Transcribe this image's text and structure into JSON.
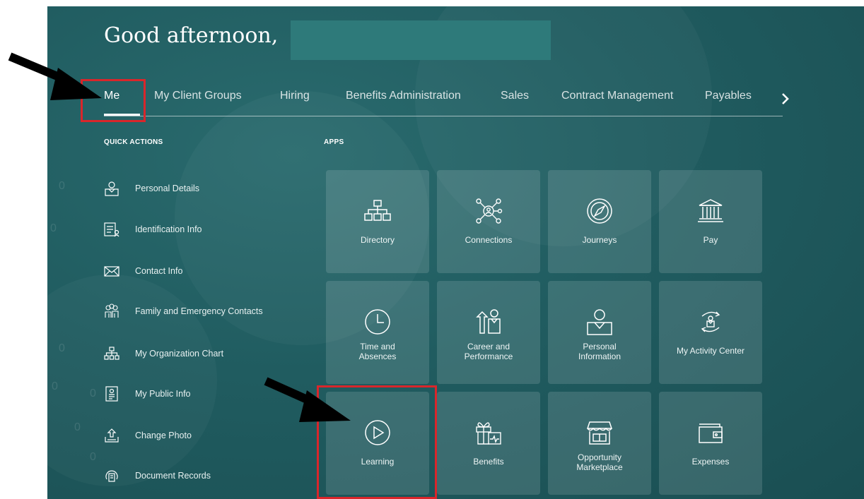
{
  "greeting": "Good afternoon,",
  "nav": {
    "tabs": [
      "Me",
      "My Client Groups",
      "Hiring",
      "Benefits Administration",
      "Sales",
      "Contract Management",
      "Payables"
    ],
    "active": "Me",
    "next_icon": "chevron-right-icon"
  },
  "quick_actions": {
    "title": "QUICK ACTIONS",
    "items": [
      {
        "label": "Personal Details",
        "icon": "person-icon"
      },
      {
        "label": "Identification Info",
        "icon": "id-document-icon"
      },
      {
        "label": "Contact Info",
        "icon": "envelope-icon"
      },
      {
        "label": "Family and Emergency Contacts",
        "icon": "family-icon"
      },
      {
        "label": "My Organization Chart",
        "icon": "org-chart-icon"
      },
      {
        "label": "My Public Info",
        "icon": "badge-icon"
      },
      {
        "label": "Change Photo",
        "icon": "upload-photo-icon"
      },
      {
        "label": "Document Records",
        "icon": "document-records-icon"
      }
    ]
  },
  "apps": {
    "title": "APPS",
    "tiles": [
      {
        "label": "Directory",
        "icon": "directory-icon"
      },
      {
        "label": "Connections",
        "icon": "connections-icon"
      },
      {
        "label": "Journeys",
        "icon": "compass-icon"
      },
      {
        "label": "Pay",
        "icon": "bank-icon"
      },
      {
        "label": "Time and\nAbsences",
        "icon": "clock-icon"
      },
      {
        "label": "Career and\nPerformance",
        "icon": "career-icon"
      },
      {
        "label": "Personal\nInformation",
        "icon": "person-icon"
      },
      {
        "label": "My Activity Center",
        "icon": "activity-icon"
      },
      {
        "label": "Learning",
        "icon": "play-icon"
      },
      {
        "label": "Benefits",
        "icon": "gift-icon"
      },
      {
        "label": "Opportunity\nMarketplace",
        "icon": "storefront-icon"
      },
      {
        "label": "Expenses",
        "icon": "wallet-icon"
      }
    ]
  },
  "colors": {
    "background": "#1f5b5e",
    "highlight": "#d9262b",
    "arrow": "#000000"
  }
}
